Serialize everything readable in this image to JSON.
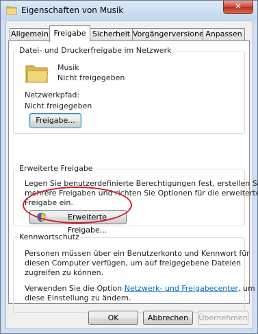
{
  "window": {
    "title": "Eigenschaften von Musik",
    "close_label": "✕"
  },
  "tabs": [
    {
      "label": "Allgemein"
    },
    {
      "label": "Freigabe"
    },
    {
      "label": "Sicherheit"
    },
    {
      "label": "Vorgängerversionen"
    },
    {
      "label": "Anpassen"
    }
  ],
  "sharing": {
    "group_title": "Datei- und Druckerfreigabe im Netzwerk",
    "folder_name": "Musik",
    "folder_status": "Nicht freigegeben",
    "network_path_label": "Netzwerkpfad:",
    "network_path_value": "Nicht freigegeben",
    "share_button": "Freigabe..."
  },
  "advanced": {
    "group_title": "Erweiterte Freigabe",
    "description_line1": "Legen Sie benutzerdefinierte Berechtigungen fest, erstellen Sie",
    "description_line2": "mehrere Freigaben und richten Sie Optionen für die erweiterte",
    "description_line3": "Freigabe ein.",
    "button": "Erweiterte Freigabe..."
  },
  "password": {
    "group_title": "Kennwortschutz",
    "line1": "Personen müssen über ein Benutzerkonto und Kennwort für",
    "line2": "diesen Computer verfügen, um auf freigegebene Dateien",
    "line3": "zugreifen zu können.",
    "line4_prefix": "Verwenden Sie die Option",
    "link": "Netzwerk- und Freigabecenter",
    "line4_suffix": ", um",
    "line5": "diese Einstellung zu ändern."
  },
  "footer": {
    "ok": "OK",
    "cancel": "Abbrechen",
    "apply": "Übernehmen"
  },
  "colors": {
    "highlight_ellipse": "#d0202a",
    "link": "#0066cc"
  }
}
